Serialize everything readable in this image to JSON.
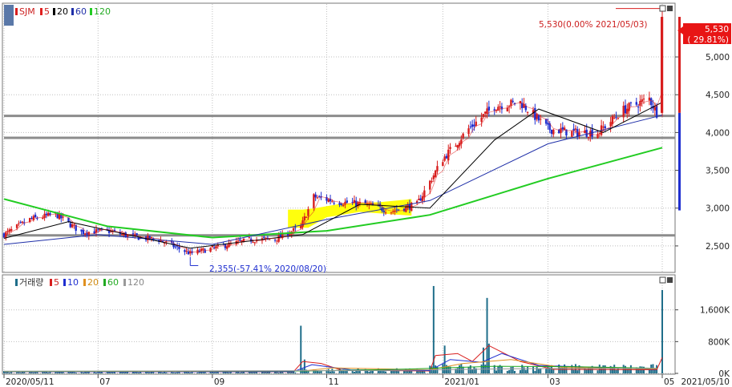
{
  "legend_price": {
    "ticker": "SJM",
    "ma": [
      "5",
      "20",
      "60",
      "120"
    ]
  },
  "legend_volume": {
    "title": "거래량",
    "ma": [
      "5",
      "10",
      "20",
      "60",
      "120"
    ]
  },
  "annotations": {
    "high": "5,530(0.00% 2021/05/03)",
    "low": "2,355(-57.41% 2020/08/20)",
    "last_price": "5,530",
    "last_change": "( 29.81%)"
  },
  "colors": {
    "up": "#d81e1e",
    "down": "#1f2fd0",
    "ma5": "#e0201f",
    "ma20": "#000000",
    "ma60": "#1f2fa8",
    "ma120": "#22cc22",
    "vol_bar": "#1f6e8a",
    "highlight": "#ffff00",
    "hline": "#8c8c8c",
    "frame": "#777777"
  },
  "chart_data": [
    {
      "type": "candlestick",
      "title": "SJM",
      "y_ticks": [
        "5,000",
        "4,500",
        "4,000",
        "3,500",
        "3,000",
        "2,500"
      ],
      "y_tick_values": [
        5000,
        4500,
        4000,
        3500,
        3000,
        2500
      ],
      "ylim": [
        2160,
        5700
      ],
      "x_ticks": [
        "2020/05/11",
        "07",
        "09",
        "11",
        "2021/01",
        "03",
        "05"
      ],
      "x_range": [
        "2020/05/11",
        "2021/05/10"
      ],
      "x_end_label": "2021/05/10",
      "support_lines": [
        4220,
        3930,
        2640
      ],
      "approx_close_series": [
        {
          "date": "2020/05/11",
          "close": 2650
        },
        {
          "date": "2020/05/25",
          "close": 2850
        },
        {
          "date": "2020/06/08",
          "close": 2920
        },
        {
          "date": "2020/06/22",
          "close": 2680
        },
        {
          "date": "2020/07/06",
          "close": 2700
        },
        {
          "date": "2020/07/20",
          "close": 2620
        },
        {
          "date": "2020/08/03",
          "close": 2580
        },
        {
          "date": "2020/08/20",
          "close": 2400
        },
        {
          "date": "2020/09/07",
          "close": 2500
        },
        {
          "date": "2020/09/21",
          "close": 2580
        },
        {
          "date": "2020/10/05",
          "close": 2590
        },
        {
          "date": "2020/10/19",
          "close": 2750
        },
        {
          "date": "2020/10/26",
          "close": 3150
        },
        {
          "date": "2020/11/09",
          "close": 3080
        },
        {
          "date": "2020/11/23",
          "close": 3050
        },
        {
          "date": "2020/12/07",
          "close": 2960
        },
        {
          "date": "2020/12/21",
          "close": 3050
        },
        {
          "date": "2021/01/04",
          "close": 3650
        },
        {
          "date": "2021/01/18",
          "close": 4050
        },
        {
          "date": "2021/02/01",
          "close": 4350
        },
        {
          "date": "2021/02/15",
          "close": 4400
        },
        {
          "date": "2021/03/02",
          "close": 4050
        },
        {
          "date": "2021/03/15",
          "close": 4000
        },
        {
          "date": "2021/03/29",
          "close": 4000
        },
        {
          "date": "2021/04/12",
          "close": 4300
        },
        {
          "date": "2021/04/26",
          "close": 4450
        },
        {
          "date": "2021/04/30",
          "close": 4260
        },
        {
          "date": "2021/05/03",
          "close": 5530
        }
      ],
      "ma120_points": [
        {
          "date": "2020/05/11",
          "value": 3120
        },
        {
          "date": "2020/07/06",
          "value": 2760
        },
        {
          "date": "2020/09/01",
          "value": 2610
        },
        {
          "date": "2020/11/02",
          "value": 2700
        },
        {
          "date": "2020/12/28",
          "value": 2910
        },
        {
          "date": "2021/03/02",
          "value": 3390
        },
        {
          "date": "2021/05/03",
          "value": 3800
        }
      ],
      "ma60_points": [
        {
          "date": "2020/05/11",
          "value": 2520
        },
        {
          "date": "2020/07/01",
          "value": 2650
        },
        {
          "date": "2020/09/01",
          "value": 2520
        },
        {
          "date": "2020/11/02",
          "value": 2850
        },
        {
          "date": "2020/12/28",
          "value": 3100
        },
        {
          "date": "2021/03/02",
          "value": 3850
        },
        {
          "date": "2021/05/03",
          "value": 4230
        }
      ],
      "ma20_points": [
        {
          "date": "2020/05/11",
          "value": 2600
        },
        {
          "date": "2020/06/15",
          "value": 2820
        },
        {
          "date": "2020/08/20",
          "value": 2470
        },
        {
          "date": "2020/10/20",
          "value": 2650
        },
        {
          "date": "2020/11/20",
          "value": 3050
        },
        {
          "date": "2020/12/28",
          "value": 3000
        },
        {
          "date": "2021/02/01",
          "value": 3900
        },
        {
          "date": "2021/02/25",
          "value": 4310
        },
        {
          "date": "2021/04/01",
          "value": 4000
        },
        {
          "date": "2021/05/03",
          "value": 4400
        }
      ]
    },
    {
      "type": "bar",
      "title": "거래량",
      "y_ticks": [
        "1,600K",
        "800K",
        "0K"
      ],
      "y_tick_values": [
        1600000,
        800000,
        0
      ],
      "ylim": [
        0,
        2300000
      ],
      "spikes": [
        {
          "date": "2020/10/19",
          "value": 1200000
        },
        {
          "date": "2020/12/30",
          "value": 2200000
        },
        {
          "date": "2021/01/28",
          "value": 1900000
        },
        {
          "date": "2021/05/03",
          "value": 2100000
        }
      ]
    }
  ]
}
